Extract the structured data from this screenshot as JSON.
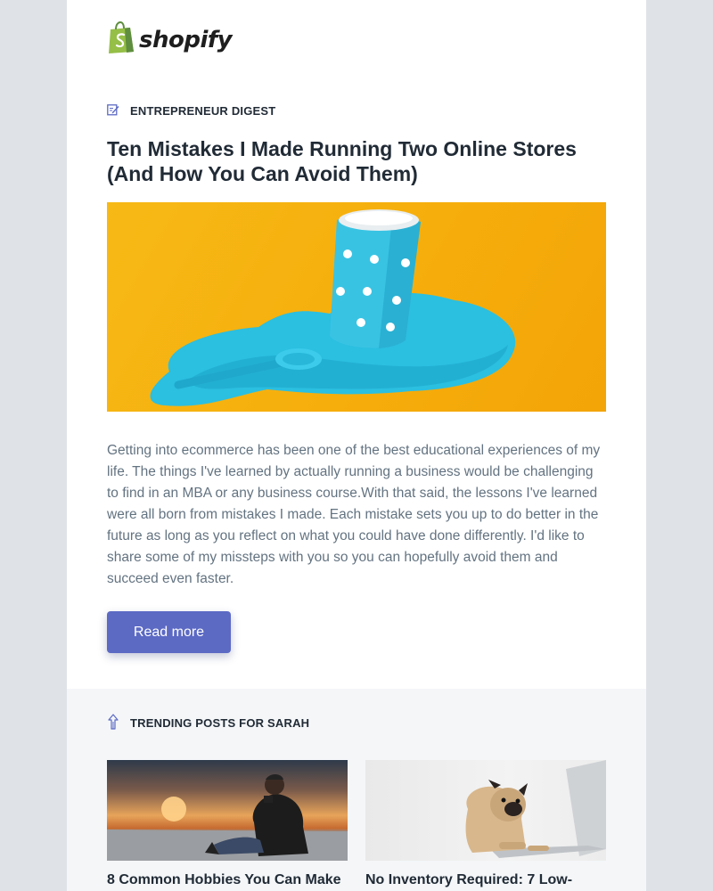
{
  "brand": {
    "name": "shopify"
  },
  "digest": {
    "label": "ENTREPRENEUR DIGEST",
    "title": "Ten Mistakes I Made Running Two Online Stores (And How You Can Avoid Them)",
    "body": "Getting into ecommerce has been one of the best educational experiences of my life. The things I've learned by actually running a business would be challenging to find in an MBA or any business course.With that said, the lessons I've learned were all born from mistakes I made. Each mistake sets you up to do better in the future as long as you reflect on what you could have done differently. I'd like to share some of my missteps with you so you can hopefully avoid them and succeed even faster.",
    "cta": "Read more"
  },
  "trending": {
    "label": "TRENDING POSTS FOR SARAH",
    "posts": [
      {
        "title": "8 Common Hobbies You Can Make"
      },
      {
        "title": "No Inventory Required: 7 Low-"
      }
    ]
  },
  "colors": {
    "accent": "#5c6ac4",
    "brand_green": "#95bf47",
    "page_bg": "#dfe3e8",
    "trending_bg": "#f4f6f8"
  },
  "icons": {
    "logo": "shopify-bag-icon",
    "digest": "edit-note-icon",
    "trending": "trending-arrow-icon"
  }
}
